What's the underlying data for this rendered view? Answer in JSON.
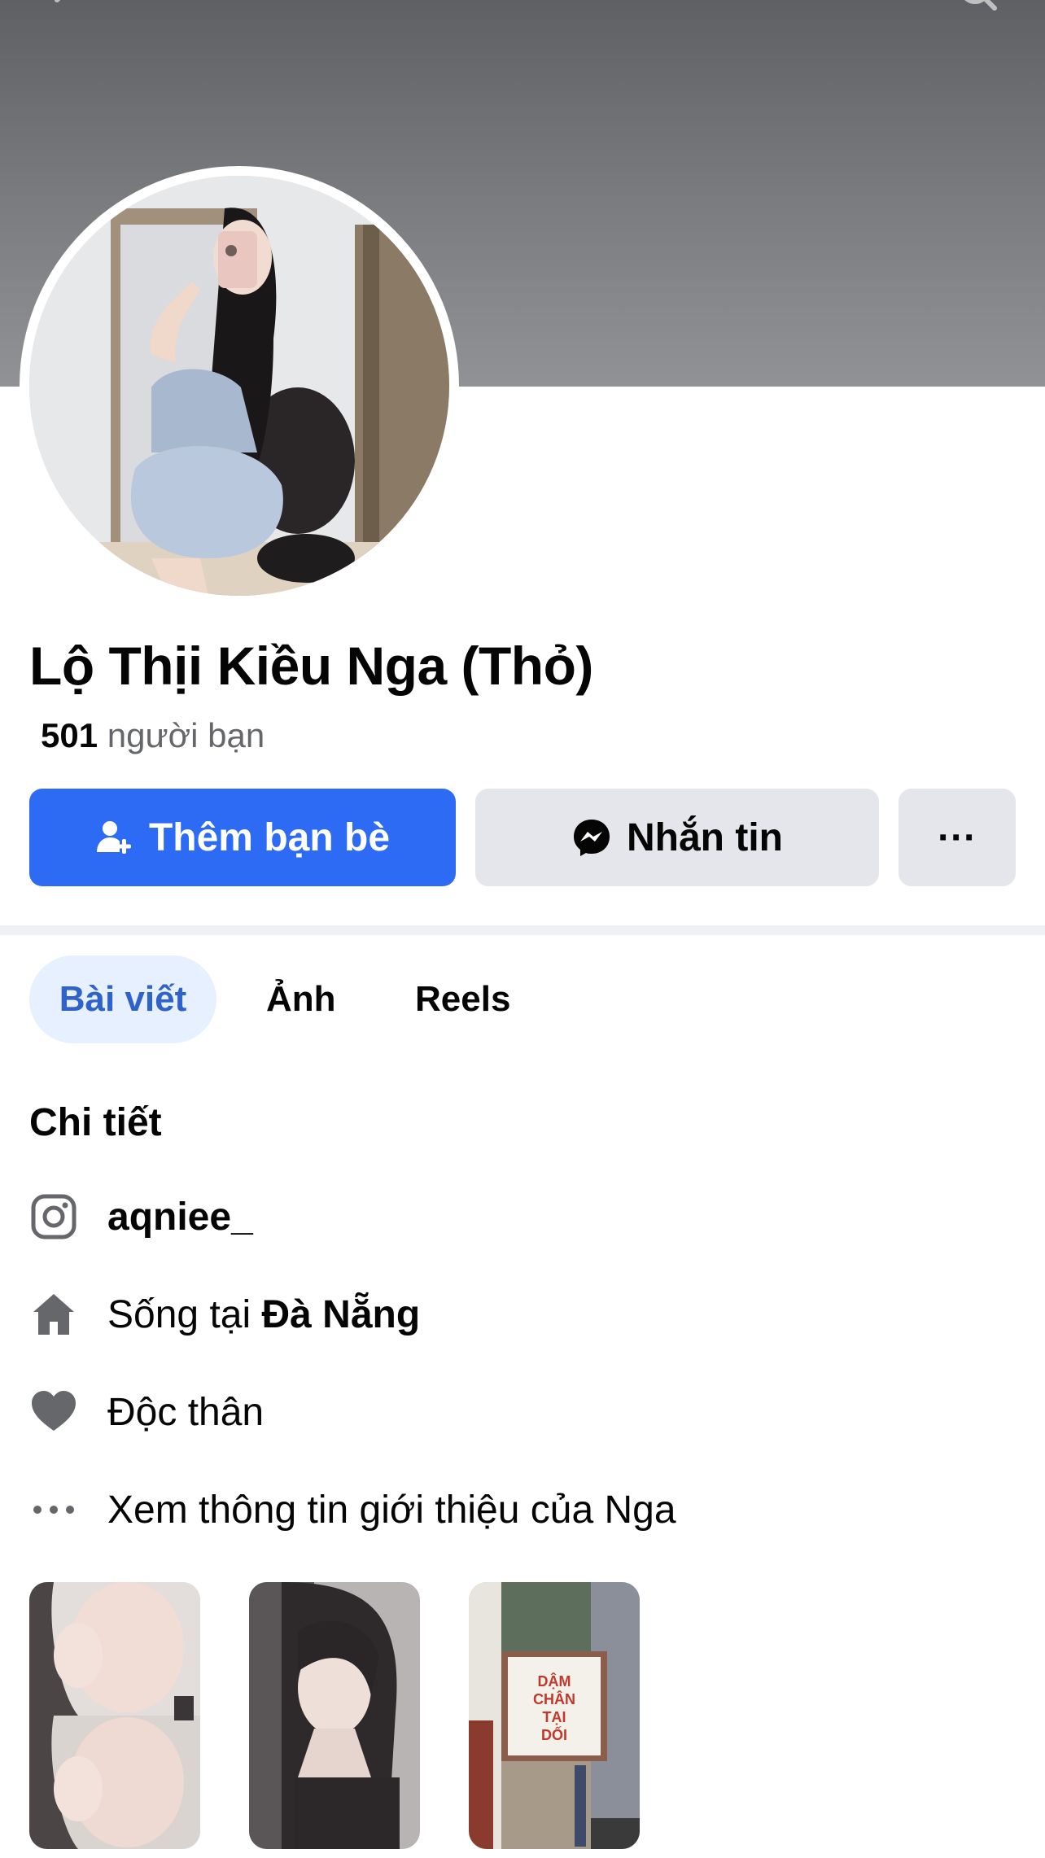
{
  "profile": {
    "name": "Lộ Thịi Kiều Nga (Thỏ)",
    "friends_count": "501",
    "friends_label": "người bạn"
  },
  "actions": {
    "add_friend": "Thêm bạn bè",
    "message": "Nhắn tin",
    "more": "···"
  },
  "tabs": [
    {
      "label": "Bài viết",
      "active": true
    },
    {
      "label": "Ảnh",
      "active": false
    },
    {
      "label": "Reels",
      "active": false
    }
  ],
  "details": {
    "title": "Chi tiết",
    "instagram": "aqniee_",
    "lives_prefix": "Sống tại",
    "lives_city": "Đà Nẵng",
    "relationship": "Độc thân",
    "see_about": "Xem thông tin giới thiệu của Nga"
  },
  "featured": {
    "sign_text": "DẬM CHÂN TẠI DỐI"
  },
  "colors": {
    "primary_blue": "#2e6bf5",
    "secondary_gray": "#e4e6eb",
    "active_tab_bg": "#e7f0fe",
    "active_tab_text": "#2f63c9",
    "icon_gray": "#65676b"
  },
  "icons": [
    "back-icon",
    "search-icon",
    "add-friend-icon",
    "messenger-icon",
    "instagram-icon",
    "home-icon",
    "heart-icon",
    "more-dots-icon"
  ]
}
